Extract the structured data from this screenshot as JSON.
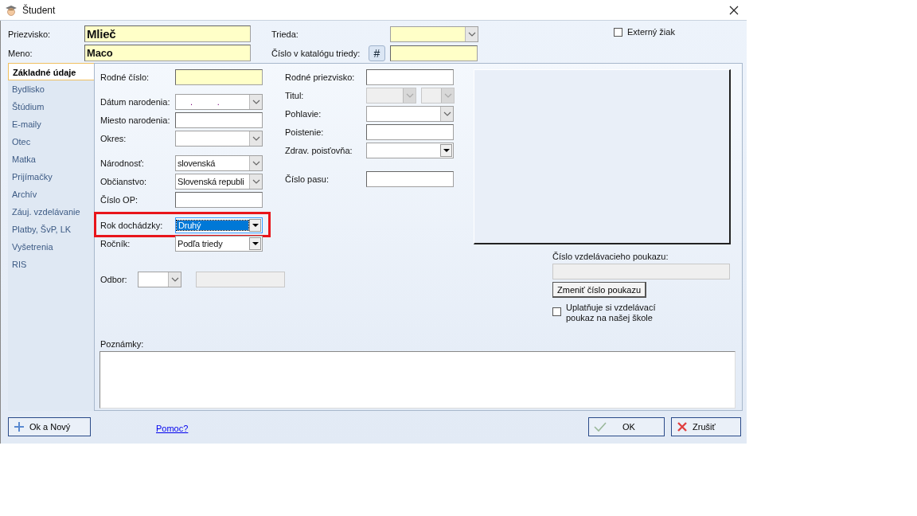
{
  "window": {
    "title": "Študent"
  },
  "header": {
    "fields": [
      {
        "label": "Priezvisko:",
        "value": "Mlieč",
        "required": true
      },
      {
        "label": "Meno:",
        "value": "Maco",
        "required": true
      }
    ],
    "trieda": {
      "label": "Trieda:",
      "required": true
    },
    "catalog": {
      "label": "Číslo v katalógu triedy:",
      "button": "#",
      "required": true
    },
    "external": {
      "label": "Externý žiak",
      "checked": false
    }
  },
  "tabs": [
    {
      "label": "Základné údaje",
      "selected": true
    },
    {
      "label": "Bydlisko",
      "selected": false
    },
    {
      "label": "Štúdium",
      "selected": false
    },
    {
      "label": "E-maily",
      "selected": false
    },
    {
      "label": "Otec",
      "selected": false
    },
    {
      "label": "Matka",
      "selected": false
    },
    {
      "label": "Prijímačky",
      "selected": false
    },
    {
      "label": "Archív",
      "selected": false
    },
    {
      "label": "Záuj. vzdelávanie",
      "selected": false
    },
    {
      "label": "Platby, ŠvP, LK",
      "selected": false
    },
    {
      "label": "Vyšetrenia",
      "selected": false
    },
    {
      "label": "RIS",
      "selected": false
    }
  ],
  "column_1": [
    {
      "label": "Rodné číslo:",
      "kind": "text",
      "required": true,
      "disabled": false,
      "focused": false
    },
    {
      "label": "Dátum narodenia:",
      "kind": "date",
      "value": ". .",
      "required": false,
      "disabled": false,
      "focused": false
    },
    {
      "label": "Miesto narodenia:",
      "kind": "text",
      "required": false,
      "disabled": false,
      "focused": false
    },
    {
      "label": "Okres:",
      "kind": "combo",
      "required": false,
      "disabled": false,
      "focused": false
    },
    {
      "label": "Národnosť:",
      "kind": "combo",
      "value": "slovenská",
      "required": false,
      "disabled": false,
      "focused": false
    },
    {
      "label": "Občianstvo:",
      "kind": "combo",
      "value": "Slovenská republi",
      "required": false,
      "disabled": false,
      "focused": false
    },
    {
      "label": "Číslo OP:",
      "kind": "text",
      "required": false,
      "disabled": false,
      "focused": false
    },
    {
      "label": "Rok dochádzky:",
      "kind": "dropdown",
      "value": "Druhý",
      "required": false,
      "disabled": false,
      "focused": true
    },
    {
      "label": "Ročník:",
      "kind": "dropdown",
      "value": "Podľa triedy",
      "required": false,
      "disabled": false,
      "focused": false
    },
    {
      "label": "Odbor:",
      "kind": "combo-text",
      "required": false,
      "disabled": false,
      "focused": false
    }
  ],
  "column_2": [
    {
      "label": "Rodné priezvisko:",
      "kind": "text",
      "required": false,
      "disabled": false,
      "focused": false
    },
    {
      "label": "Titul:",
      "kind": "combo-pair",
      "required": false,
      "disabled": true,
      "focused": false
    },
    {
      "label": "Pohlavie:",
      "kind": "combo",
      "required": false,
      "disabled": false,
      "focused": false
    },
    {
      "label": "Poistenie:",
      "kind": "text",
      "required": false,
      "disabled": false,
      "focused": false
    },
    {
      "label": "Zdrav. poisťovňa:",
      "kind": "dropdown",
      "required": false,
      "disabled": false,
      "focused": false
    },
    {
      "label": "Číslo pasu:",
      "kind": "text",
      "required": false,
      "disabled": false,
      "focused": false
    }
  ],
  "voucher": {
    "label": "Číslo vzdelávacieho poukazu:",
    "disabled": true,
    "button": "Zmeniť číslo poukazu",
    "checkbox": {
      "label": "Uplatňuje si vzdelávací poukaz na našej škole",
      "checked": false
    }
  },
  "notes": {
    "label": "Poznámky:"
  },
  "footer": {
    "ok_new": "Ok a Nový",
    "help": "Pomoc?",
    "ok": "OK",
    "cancel": "Zrušiť"
  }
}
